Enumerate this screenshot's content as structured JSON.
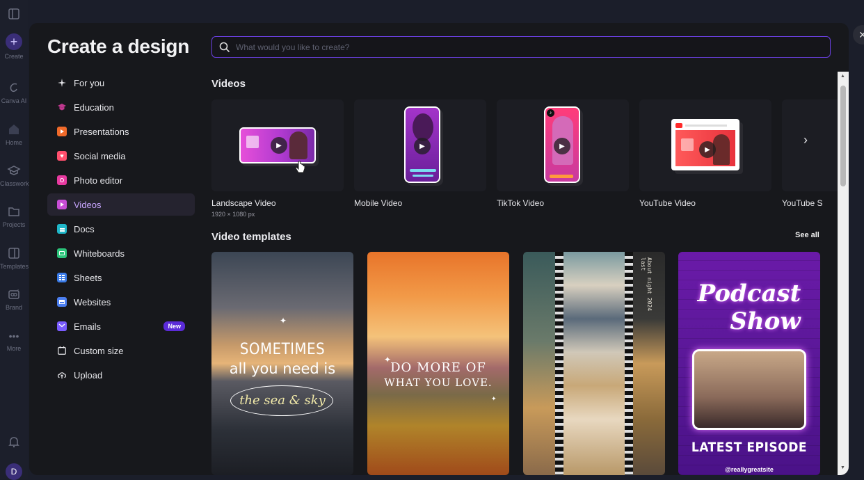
{
  "rail": {
    "items": [
      {
        "label": "Create"
      },
      {
        "label": "Canva AI"
      },
      {
        "label": "Home"
      },
      {
        "label": "Classwork"
      },
      {
        "label": "Projects"
      },
      {
        "label": "Templates"
      },
      {
        "label": "Brand"
      },
      {
        "label": "More"
      }
    ],
    "avatar_initial": "D"
  },
  "modal": {
    "title": "Create a design",
    "search_placeholder": "What would you like to create?"
  },
  "sidebar": {
    "items": [
      {
        "label": "For you",
        "color": "#e6e6ea"
      },
      {
        "label": "Education",
        "color": "#c0388f"
      },
      {
        "label": "Presentations",
        "color": "#f06a2a"
      },
      {
        "label": "Social media",
        "color": "#ff4f6d"
      },
      {
        "label": "Photo editor",
        "color": "#e83aa0"
      },
      {
        "label": "Videos",
        "color": "#c84dd6"
      },
      {
        "label": "Docs",
        "color": "#1fb7c9"
      },
      {
        "label": "Whiteboards",
        "color": "#2bc47a"
      },
      {
        "label": "Sheets",
        "color": "#3a7be8"
      },
      {
        "label": "Websites",
        "color": "#4b7ef0"
      },
      {
        "label": "Emails",
        "color": "#7a5cff",
        "badge": "New"
      },
      {
        "label": "Custom size",
        "color": "#e6e6ea"
      },
      {
        "label": "Upload",
        "color": "#e6e6ea"
      }
    ]
  },
  "videos": {
    "title": "Videos",
    "cards": [
      {
        "label": "Landscape Video",
        "sub": "1920 × 1080 px"
      },
      {
        "label": "Mobile Video",
        "sub": ""
      },
      {
        "label": "TikTok Video",
        "sub": ""
      },
      {
        "label": "YouTube Video",
        "sub": ""
      },
      {
        "label": "YouTube S",
        "sub": ""
      }
    ]
  },
  "templates": {
    "title": "Video templates",
    "see_all": "See all",
    "items": [
      {
        "line1": "SOMETIMES",
        "line2": "all you need is",
        "line3": "the sea & sky"
      },
      {
        "line1": "DO MORE OF",
        "line2": "WHAT YOU LOVE."
      },
      {
        "side_text": "About night 2024 last"
      },
      {
        "line1": "Podcast",
        "line2": "Show",
        "line3": "LATEST EPISODE",
        "handle": "@reallygreatsite"
      }
    ]
  }
}
